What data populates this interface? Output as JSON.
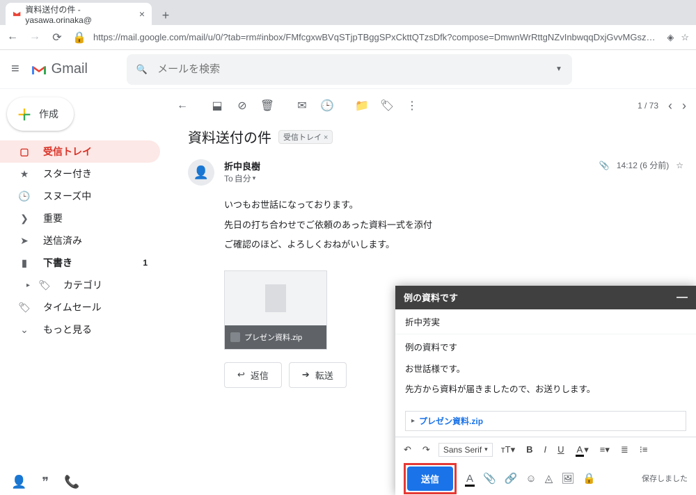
{
  "browser": {
    "tab_title": "資料送付の件 - yasawa.orinaka@",
    "url_display": "https://mail.google.com/mail/u/0/?tab=rm#inbox/FMfcgxwBVqSTjpTBggSPxCkttQTzsDfk?compose=DmwnWrRttgNZvInbwqqDxjGvvMGszbtNsHx..."
  },
  "header": {
    "logo_text": "Gmail",
    "search_placeholder": "メールを検索"
  },
  "sidebar": {
    "compose": "作成",
    "items": [
      {
        "icon": "inbox",
        "label": "受信トレイ"
      },
      {
        "icon": "star",
        "label": "スター付き"
      },
      {
        "icon": "clock",
        "label": "スヌーズ中"
      },
      {
        "icon": "chev",
        "label": "重要"
      },
      {
        "icon": "send",
        "label": "送信済み"
      },
      {
        "icon": "draft",
        "label": "下書き",
        "count": "1"
      },
      {
        "icon": "label",
        "label": "カテゴリ"
      },
      {
        "icon": "label",
        "label": "タイムセール"
      },
      {
        "icon": "more",
        "label": "もっと見る"
      }
    ]
  },
  "toolbar": {
    "position": "1 / 73"
  },
  "thread": {
    "subject": "資料送付の件",
    "chip": "受信トレイ",
    "from": "折中良樹",
    "to_prefix": "To",
    "to": "自分",
    "time": "14:12 (6 分前)",
    "body1": "いつもお世話になっております。",
    "body2": "先日の打ち合わせでご依頼のあった資料一式を添付",
    "body3": "ご確認のほど、よろしくおねがいします。",
    "attachment": "プレゼン資料.zip",
    "reply": "返信",
    "forward": "転送"
  },
  "compose": {
    "subject": "例の資料です",
    "to": "折中芳実",
    "subj_line": "例の資料です",
    "b1": "お世話様です。",
    "b2": "先方から資料が届きましたので、お送りします。",
    "attachment": "プレゼン資料.zip",
    "font": "Sans Serif",
    "send": "送信",
    "saved": "保存しました"
  }
}
